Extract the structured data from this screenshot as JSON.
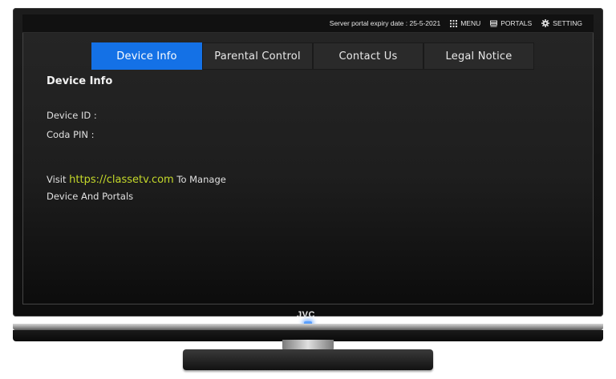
{
  "topbar": {
    "expiry_text": "Server portal expiry date : 25-5-2021",
    "menu_label": "MENU",
    "portals_label": "PORTALS",
    "setting_label": "SETTING",
    "icons": {
      "menu": "grid-icon",
      "portals": "portals-icon",
      "setting": "gear-icon"
    }
  },
  "tabs": [
    {
      "label": "Device Info",
      "active": true
    },
    {
      "label": "Parental Control",
      "active": false
    },
    {
      "label": "Contact Us",
      "active": false
    },
    {
      "label": "Legal Notice",
      "active": false
    }
  ],
  "content": {
    "title": "Device Info",
    "device_id_label": "Device ID :",
    "coda_pin_label": "Coda PIN :",
    "visit_prefix": "Visit",
    "visit_link": "https://classetv.com",
    "visit_suffix": "To Manage",
    "visit_line2": "Device And Portals"
  },
  "tv": {
    "brand": "JVC"
  },
  "colors": {
    "accent": "#1471e6",
    "link": "#c4d82a",
    "screen_bg": "#222222"
  }
}
